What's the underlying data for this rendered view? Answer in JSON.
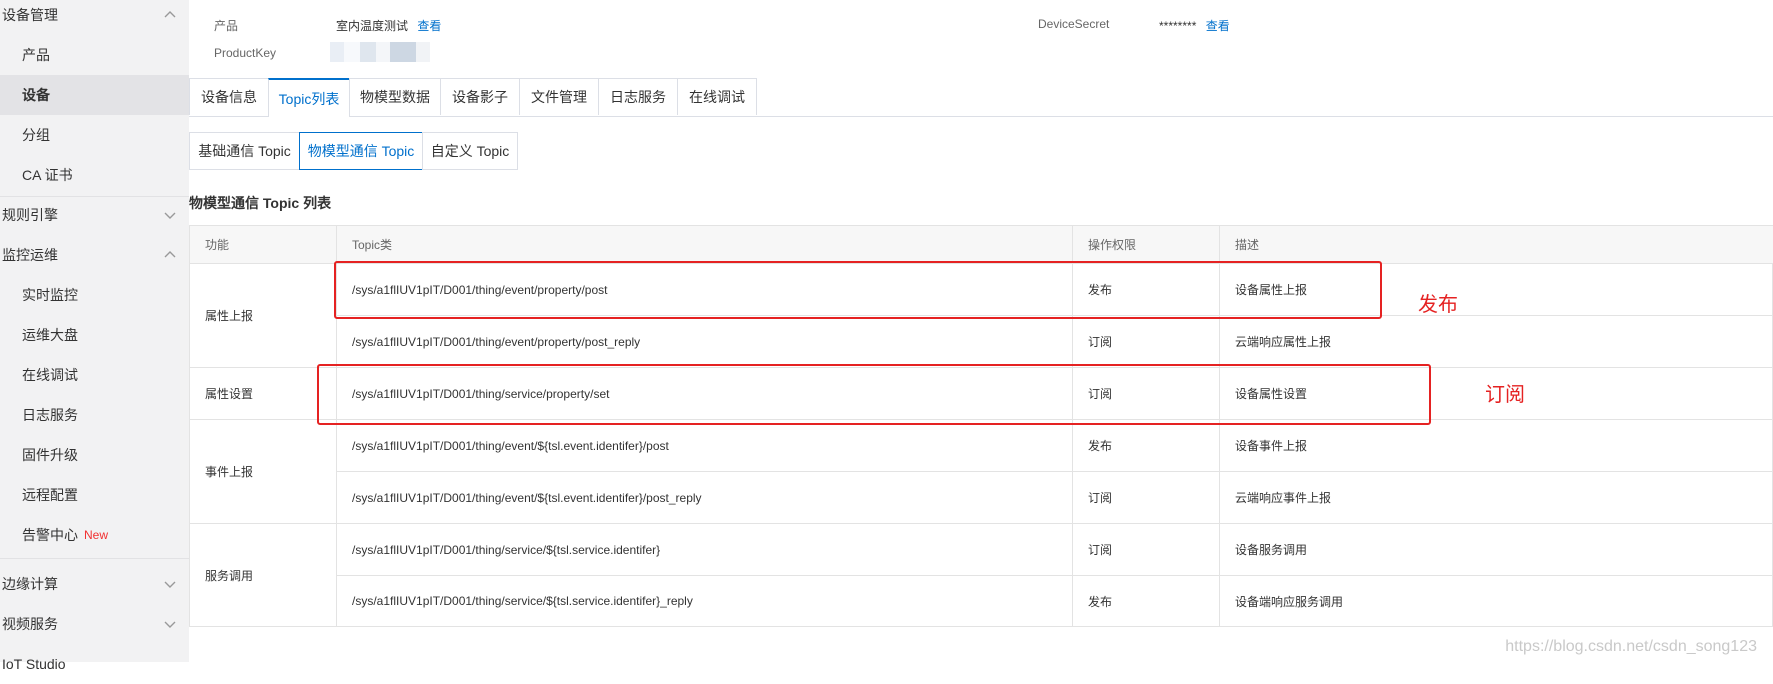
{
  "sidebar": {
    "sections": [
      {
        "label": "设备管理",
        "expanded": true
      },
      {
        "label": "规则引擎",
        "expanded": false
      },
      {
        "label": "监控运维",
        "expanded": true
      },
      {
        "label": "边缘计算",
        "expanded": false
      },
      {
        "label": "视频服务",
        "expanded": false
      }
    ],
    "device_items": [
      "产品",
      "设备",
      "分组",
      "CA 证书"
    ],
    "monitor_items": [
      "实时监控",
      "运维大盘",
      "在线调试",
      "日志服务",
      "固件升级",
      "远程配置",
      "告警中心"
    ],
    "new_badge": "New",
    "partial_bottom": "IoT Studio"
  },
  "info": {
    "product_label": "产品",
    "product_value": "室内温度测试",
    "view_link": "查看",
    "productkey_label": "ProductKey",
    "devicesecret_label": "DeviceSecret",
    "devicesecret_value": "********"
  },
  "tabs": [
    "设备信息",
    "Topic列表",
    "物模型数据",
    "设备影子",
    "文件管理",
    "日志服务",
    "在线调试"
  ],
  "subtabs": [
    "基础通信 Topic",
    "物模型通信 Topic",
    "自定义 Topic"
  ],
  "section_title": "物模型通信 Topic 列表",
  "table": {
    "headers": [
      "功能",
      "Topic类",
      "操作权限",
      "描述"
    ],
    "groups": [
      {
        "function": "属性上报",
        "rows": [
          {
            "topic": "/sys/a1flIUV1pIT/D001/thing/event/property/post",
            "perm": "发布",
            "desc": "设备属性上报"
          },
          {
            "topic": "/sys/a1flIUV1pIT/D001/thing/event/property/post_reply",
            "perm": "订阅",
            "desc": "云端响应属性上报"
          }
        ]
      },
      {
        "function": "属性设置",
        "rows": [
          {
            "topic": "/sys/a1flIUV1pIT/D001/thing/service/property/set",
            "perm": "订阅",
            "desc": "设备属性设置"
          }
        ]
      },
      {
        "function": "事件上报",
        "rows": [
          {
            "topic": "/sys/a1flIUV1pIT/D001/thing/event/${tsl.event.identifer}/post",
            "perm": "发布",
            "desc": "设备事件上报"
          },
          {
            "topic": "/sys/a1flIUV1pIT/D001/thing/event/${tsl.event.identifer}/post_reply",
            "perm": "订阅",
            "desc": "云端响应事件上报"
          }
        ]
      },
      {
        "function": "服务调用",
        "rows": [
          {
            "topic": "/sys/a1flIUV1pIT/D001/thing/service/${tsl.service.identifer}",
            "perm": "订阅",
            "desc": "设备服务调用"
          },
          {
            "topic": "/sys/a1flIUV1pIT/D001/thing/service/${tsl.service.identifer}_reply",
            "perm": "发布",
            "desc": "设备端响应服务调用"
          }
        ]
      }
    ]
  },
  "annotations": [
    "发布",
    "订阅"
  ],
  "watermark": "https://blog.csdn.net/csdn_song123",
  "colors": {
    "accent": "#0070cc",
    "annotation": "#e52222",
    "sidebar_bg": "#f2f2f3"
  }
}
